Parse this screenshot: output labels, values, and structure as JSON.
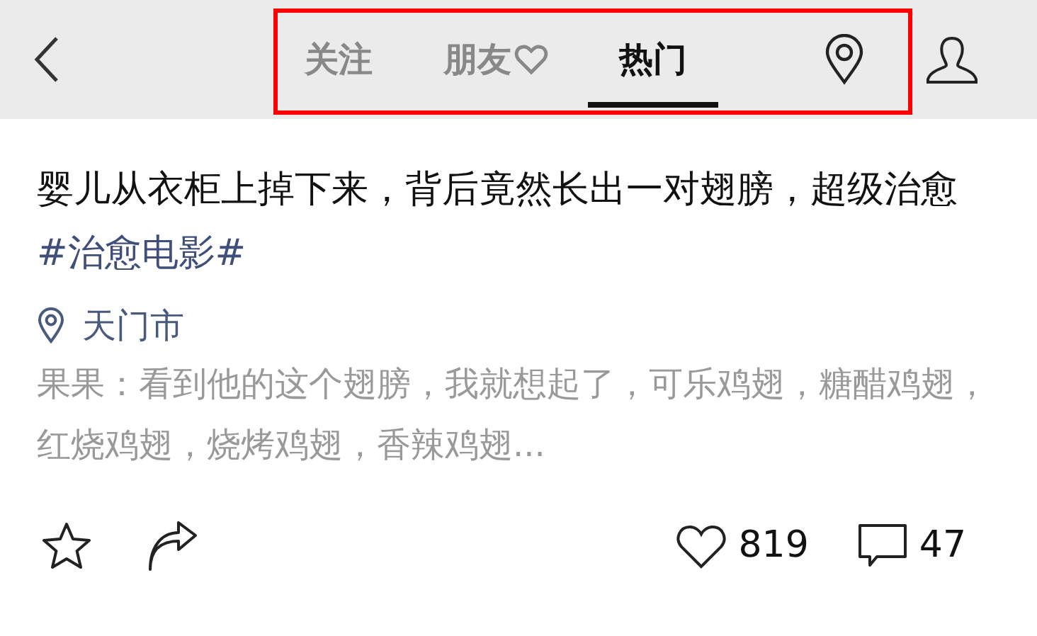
{
  "tabs": [
    {
      "label": "关注",
      "selected": false
    },
    {
      "label": "朋友",
      "selected": false,
      "kind": "heart"
    },
    {
      "label": "热门",
      "selected": true
    }
  ],
  "post": {
    "title": "婴儿从衣柜上掉下来，背后竟然长出一对翅膀，超级治愈",
    "hashtag": "#治愈电影#",
    "location": "天门市",
    "comment": "果果：看到他的这个翅膀，我就想起了，可乐鸡翅，糖醋鸡翅，红烧鸡翅，烧烤鸡翅，香辣鸡翅..."
  },
  "actions": {
    "likes": "819",
    "comments": "47"
  }
}
